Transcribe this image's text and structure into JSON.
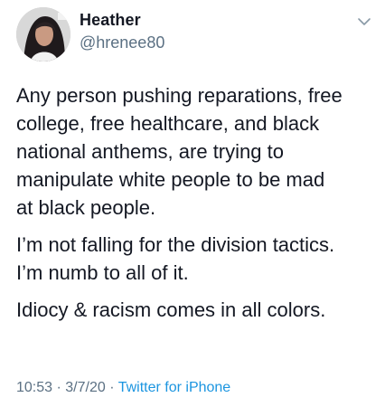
{
  "tweet": {
    "display_name": "Heather",
    "handle": "@hrenee80",
    "paragraphs": [
      {
        "lines": [
          "Any person pushing reparations, free",
          "college, free healthcare, and black",
          "national anthems, are trying to",
          "manipulate white people to be mad",
          "at black people."
        ]
      },
      {
        "lines": [
          "I’m not falling for the division tactics.",
          "I’m numb to all of it."
        ]
      },
      {
        "lines": [
          "Idiocy & racism comes in all colors."
        ]
      }
    ],
    "meta": {
      "time": "10:53",
      "separator": "·",
      "date": "3/7/20",
      "source": "Twitter for iPhone"
    },
    "icons": {
      "avatar": "profile-photo",
      "menu": "chevron-down-icon"
    },
    "colors": {
      "text": "#141823",
      "secondary": "#5b7083",
      "link": "#1b95e0"
    }
  }
}
